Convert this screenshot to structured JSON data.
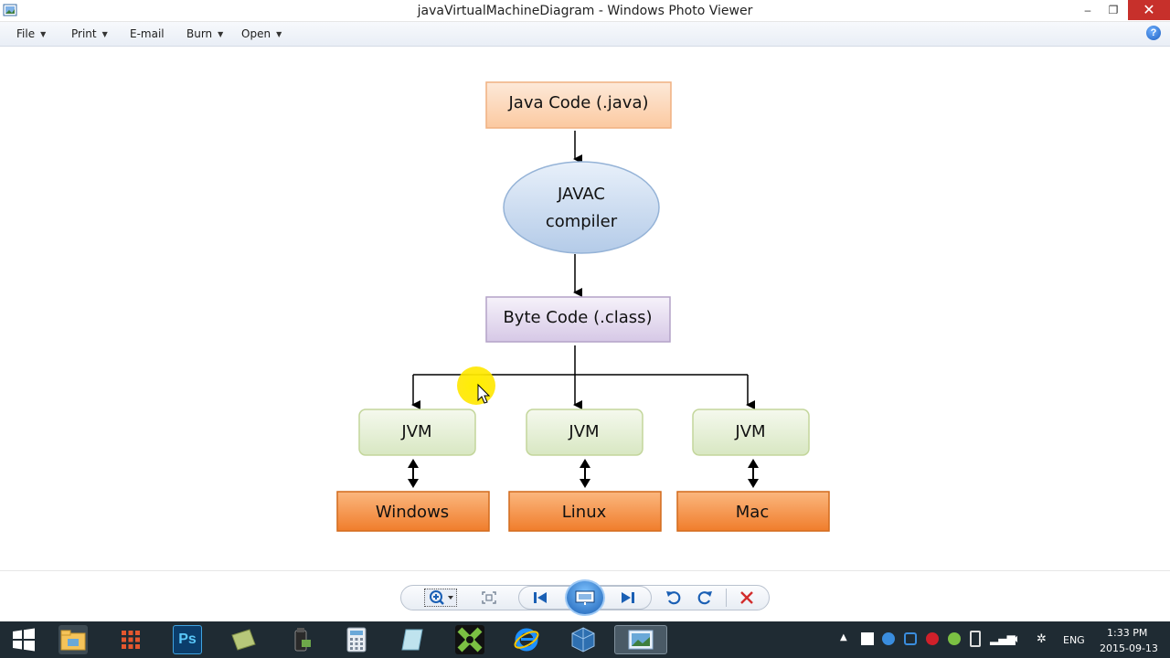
{
  "window": {
    "title": "javaVirtualMachineDiagram - Windows Photo Viewer",
    "minimize": "–",
    "maximize": "❐",
    "close": "✕"
  },
  "menu": {
    "items": [
      {
        "label": "File"
      },
      {
        "label": "Print"
      },
      {
        "label": "E-mail"
      },
      {
        "label": "Burn"
      },
      {
        "label": "Open"
      }
    ],
    "help": "?"
  },
  "diagram": {
    "source": "Java Code (.java)",
    "compiler_line1": "JAVAC",
    "compiler_line2": "compiler",
    "bytecode": "Byte Code (.class)",
    "jvms": [
      "JVM",
      "JVM",
      "JVM"
    ],
    "platforms": [
      "Windows",
      "Linux",
      "Mac"
    ]
  },
  "toolbar": {
    "icons": [
      "zoom-icon",
      "fit-icon",
      "previous-icon",
      "slideshow-icon",
      "next-icon",
      "rotate-left-icon",
      "rotate-right-icon",
      "delete-icon"
    ]
  },
  "taskbar": {
    "language": "ENG",
    "time": "1:33 PM",
    "date": "2015-09-13"
  },
  "colors": {
    "close_red": "#c7302b",
    "taskbar": "#1f2b33",
    "java_box": "#fcd5b5",
    "compiler_ellipse": "#c6d9f1",
    "bytecode_box": "#e2d7ee",
    "jvm_box": "#e4efd4",
    "platform_box": "#f79646",
    "cursor_highlight": "#ffee00"
  }
}
